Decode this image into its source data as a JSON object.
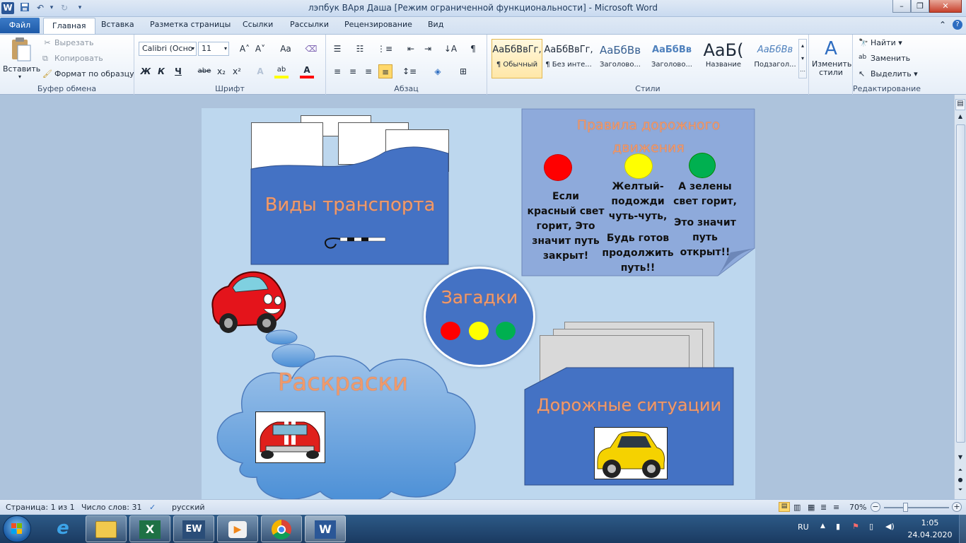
{
  "window": {
    "title": "лэпбук ВАря Даша [Режим ограниченной функциональности]  -  Microsoft Word",
    "app_icon": "W",
    "controls": {
      "minimize": "–",
      "maximize": "❐",
      "close": "✕"
    }
  },
  "tabs": {
    "file": "Файл",
    "items": [
      "Главная",
      "Вставка",
      "Разметка страницы",
      "Ссылки",
      "Рассылки",
      "Рецензирование",
      "Вид"
    ],
    "active": "Главная"
  },
  "ribbon": {
    "clipboard": {
      "paste": "Вставить",
      "cut": "Вырезать",
      "copy": "Копировать",
      "format_painter": "Формат по образцу",
      "label": "Буфер обмена"
    },
    "font": {
      "font_name": "Calibri (Осно",
      "font_size": "11",
      "label": "Шрифт",
      "bold": "Ж",
      "italic": "К",
      "underline": "Ч",
      "strike": "abe",
      "sub": "x₂",
      "sup": "x²",
      "grow": "A˄",
      "shrink": "A˅",
      "case": "Aa",
      "clear": "A",
      "highlight": "ab",
      "color": "A"
    },
    "paragraph": {
      "label": "Абзац"
    },
    "styles": {
      "label": "Стили",
      "items": [
        {
          "preview": "АаБбВвГг,",
          "name": "¶ Обычный"
        },
        {
          "preview": "АаБбВвГг,",
          "name": "¶ Без инте..."
        },
        {
          "preview": "АаБбВв",
          "name": "Заголово..."
        },
        {
          "preview": "АаБбВв",
          "name": "Заголово..."
        },
        {
          "preview": "АаБ(",
          "name": "Название"
        },
        {
          "preview": "АаБбВв",
          "name": "Подзагол..."
        }
      ],
      "change": "Изменить стили"
    },
    "editing": {
      "find": "Найти",
      "replace": "Заменить",
      "select": "Выделить",
      "label": "Редактирование"
    }
  },
  "document": {
    "transport": {
      "title": "Виды транспорта"
    },
    "rules": {
      "title": "Правила дорожного движения",
      "red_text": "Если красный свет горит, Это значит путь закрыт!",
      "yellow_text_1": "Желтый- подожди чуть-чуть,",
      "yellow_text_2": "Будь готов продолжить путь!!",
      "green_text_1": "А зелены свет горит,",
      "green_text_2": "Это значит путь открыт!!",
      "colors": {
        "red": "#ff0000",
        "yellow": "#ffff00",
        "green": "#00b050"
      }
    },
    "riddles": {
      "title": "Загадки"
    },
    "coloring": {
      "title": "Раскраски"
    },
    "situations": {
      "title": "Дорожные ситуации"
    }
  },
  "status": {
    "page": "Страница: 1 из 1",
    "words": "Число слов: 31",
    "language": "русский",
    "zoom": "70%"
  },
  "taskbar": {
    "apps": [
      "start-button",
      "internet-explorer",
      "file-explorer",
      "excel",
      "easyworship",
      "media-player",
      "chrome",
      "word"
    ],
    "lang": "RU",
    "time": "1:05",
    "date": "24.04.2020"
  }
}
